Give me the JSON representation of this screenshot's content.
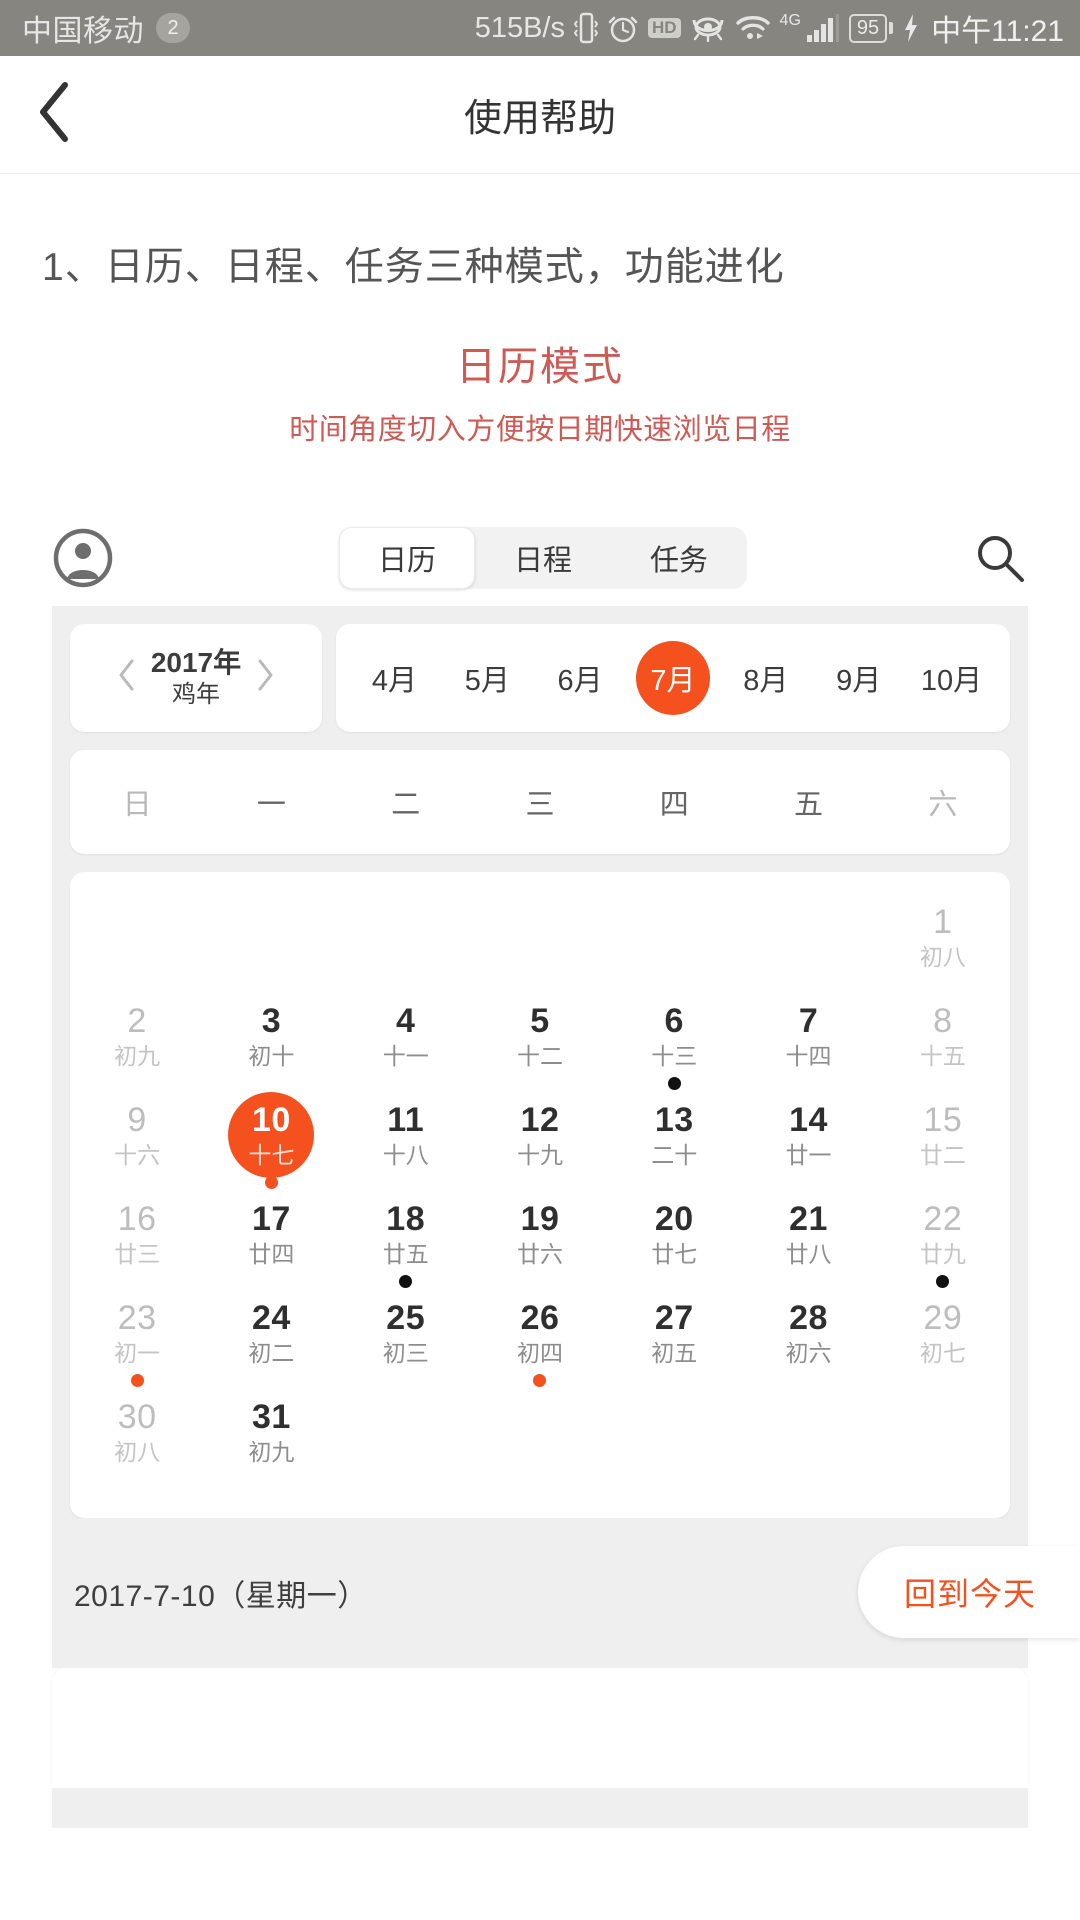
{
  "status_bar": {
    "carrier": "中国移动",
    "sim_badge": "2",
    "net_speed": "515B/s",
    "icons": [
      "vibrate-icon",
      "alarm-icon",
      "hd-icon",
      "eye-comfort-icon",
      "wifi-icon",
      "signal-icon"
    ],
    "hd_label": "HD",
    "network_type": "4G",
    "battery_level": "95",
    "charging": true,
    "time": "中午11:21"
  },
  "header": {
    "back_icon": "chevron-left-icon",
    "title": "使用帮助"
  },
  "article": {
    "section_heading": "1、日历、日程、任务三种模式，功能进化",
    "mode_title": "日历模式",
    "mode_subtitle": "时间角度切入方便按日期快速浏览日程",
    "accent_color": "#cc5b55"
  },
  "app_mock": {
    "avatar_icon": "account-circle-icon",
    "search_icon": "search-icon",
    "tabs": [
      {
        "label": "日历",
        "active": true
      },
      {
        "label": "日程",
        "active": false
      },
      {
        "label": "任务",
        "active": false
      }
    ],
    "year_selector": {
      "prev_icon": "chevron-left-icon",
      "next_icon": "chevron-right-icon",
      "year": "2017年",
      "zodiac": "鸡年"
    },
    "months": [
      {
        "label": "4月",
        "active": false
      },
      {
        "label": "5月",
        "active": false
      },
      {
        "label": "6月",
        "active": false
      },
      {
        "label": "7月",
        "active": true
      },
      {
        "label": "8月",
        "active": false
      },
      {
        "label": "9月",
        "active": false
      },
      {
        "label": "10月",
        "active": false
      }
    ],
    "weekdays": [
      {
        "label": "日",
        "weekend": true
      },
      {
        "label": "一",
        "weekend": false
      },
      {
        "label": "二",
        "weekend": false
      },
      {
        "label": "三",
        "weekend": false
      },
      {
        "label": "四",
        "weekend": false
      },
      {
        "label": "五",
        "weekend": false
      },
      {
        "label": "六",
        "weekend": true
      }
    ],
    "calendar_rows": [
      [
        {
          "num": "",
          "lunar": "",
          "empty": true
        },
        {
          "num": "",
          "lunar": "",
          "empty": true
        },
        {
          "num": "",
          "lunar": "",
          "empty": true
        },
        {
          "num": "",
          "lunar": "",
          "empty": true
        },
        {
          "num": "",
          "lunar": "",
          "empty": true
        },
        {
          "num": "",
          "lunar": "",
          "empty": true
        },
        {
          "num": "1",
          "lunar": "初八",
          "dim": true,
          "dot": ""
        }
      ],
      [
        {
          "num": "2",
          "lunar": "初九",
          "dim": true,
          "dot": ""
        },
        {
          "num": "3",
          "lunar": "初十",
          "dim": false,
          "dot": ""
        },
        {
          "num": "4",
          "lunar": "十一",
          "dim": false,
          "dot": ""
        },
        {
          "num": "5",
          "lunar": "十二",
          "dim": false,
          "dot": ""
        },
        {
          "num": "6",
          "lunar": "十三",
          "dim": false,
          "dot": "black"
        },
        {
          "num": "7",
          "lunar": "十四",
          "dim": false,
          "dot": ""
        },
        {
          "num": "8",
          "lunar": "十五",
          "dim": true,
          "dot": ""
        }
      ],
      [
        {
          "num": "9",
          "lunar": "十六",
          "dim": true,
          "dot": ""
        },
        {
          "num": "10",
          "lunar": "十七",
          "dim": false,
          "selected": true,
          "dot": "orange"
        },
        {
          "num": "11",
          "lunar": "十八",
          "dim": false,
          "dot": ""
        },
        {
          "num": "12",
          "lunar": "十九",
          "dim": false,
          "dot": ""
        },
        {
          "num": "13",
          "lunar": "二十",
          "dim": false,
          "dot": ""
        },
        {
          "num": "14",
          "lunar": "廿一",
          "dim": false,
          "dot": ""
        },
        {
          "num": "15",
          "lunar": "廿二",
          "dim": true,
          "dot": ""
        }
      ],
      [
        {
          "num": "16",
          "lunar": "廿三",
          "dim": true,
          "dot": ""
        },
        {
          "num": "17",
          "lunar": "廿四",
          "dim": false,
          "dot": ""
        },
        {
          "num": "18",
          "lunar": "廿五",
          "dim": false,
          "dot": "black"
        },
        {
          "num": "19",
          "lunar": "廿六",
          "dim": false,
          "dot": ""
        },
        {
          "num": "20",
          "lunar": "廿七",
          "dim": false,
          "dot": ""
        },
        {
          "num": "21",
          "lunar": "廿八",
          "dim": false,
          "dot": ""
        },
        {
          "num": "22",
          "lunar": "廿九",
          "dim": true,
          "dot": "black"
        }
      ],
      [
        {
          "num": "23",
          "lunar": "初一",
          "dim": true,
          "dot": "orange"
        },
        {
          "num": "24",
          "lunar": "初二",
          "dim": false,
          "dot": ""
        },
        {
          "num": "25",
          "lunar": "初三",
          "dim": false,
          "dot": ""
        },
        {
          "num": "26",
          "lunar": "初四",
          "dim": false,
          "dot": "orange"
        },
        {
          "num": "27",
          "lunar": "初五",
          "dim": false,
          "dot": ""
        },
        {
          "num": "28",
          "lunar": "初六",
          "dim": false,
          "dot": ""
        },
        {
          "num": "29",
          "lunar": "初七",
          "dim": true,
          "dot": ""
        }
      ],
      [
        {
          "num": "30",
          "lunar": "初八",
          "dim": true,
          "dot": ""
        },
        {
          "num": "31",
          "lunar": "初九",
          "dim": false,
          "dot": ""
        },
        {
          "num": "",
          "lunar": "",
          "empty": true
        },
        {
          "num": "",
          "lunar": "",
          "empty": true
        },
        {
          "num": "",
          "lunar": "",
          "empty": true
        },
        {
          "num": "",
          "lunar": "",
          "empty": true
        },
        {
          "num": "",
          "lunar": "",
          "empty": true
        }
      ]
    ],
    "footer": {
      "selected_date": "2017-7-10（星期一）",
      "today_button": "回到今天"
    },
    "accent_color": "#f4511e"
  }
}
